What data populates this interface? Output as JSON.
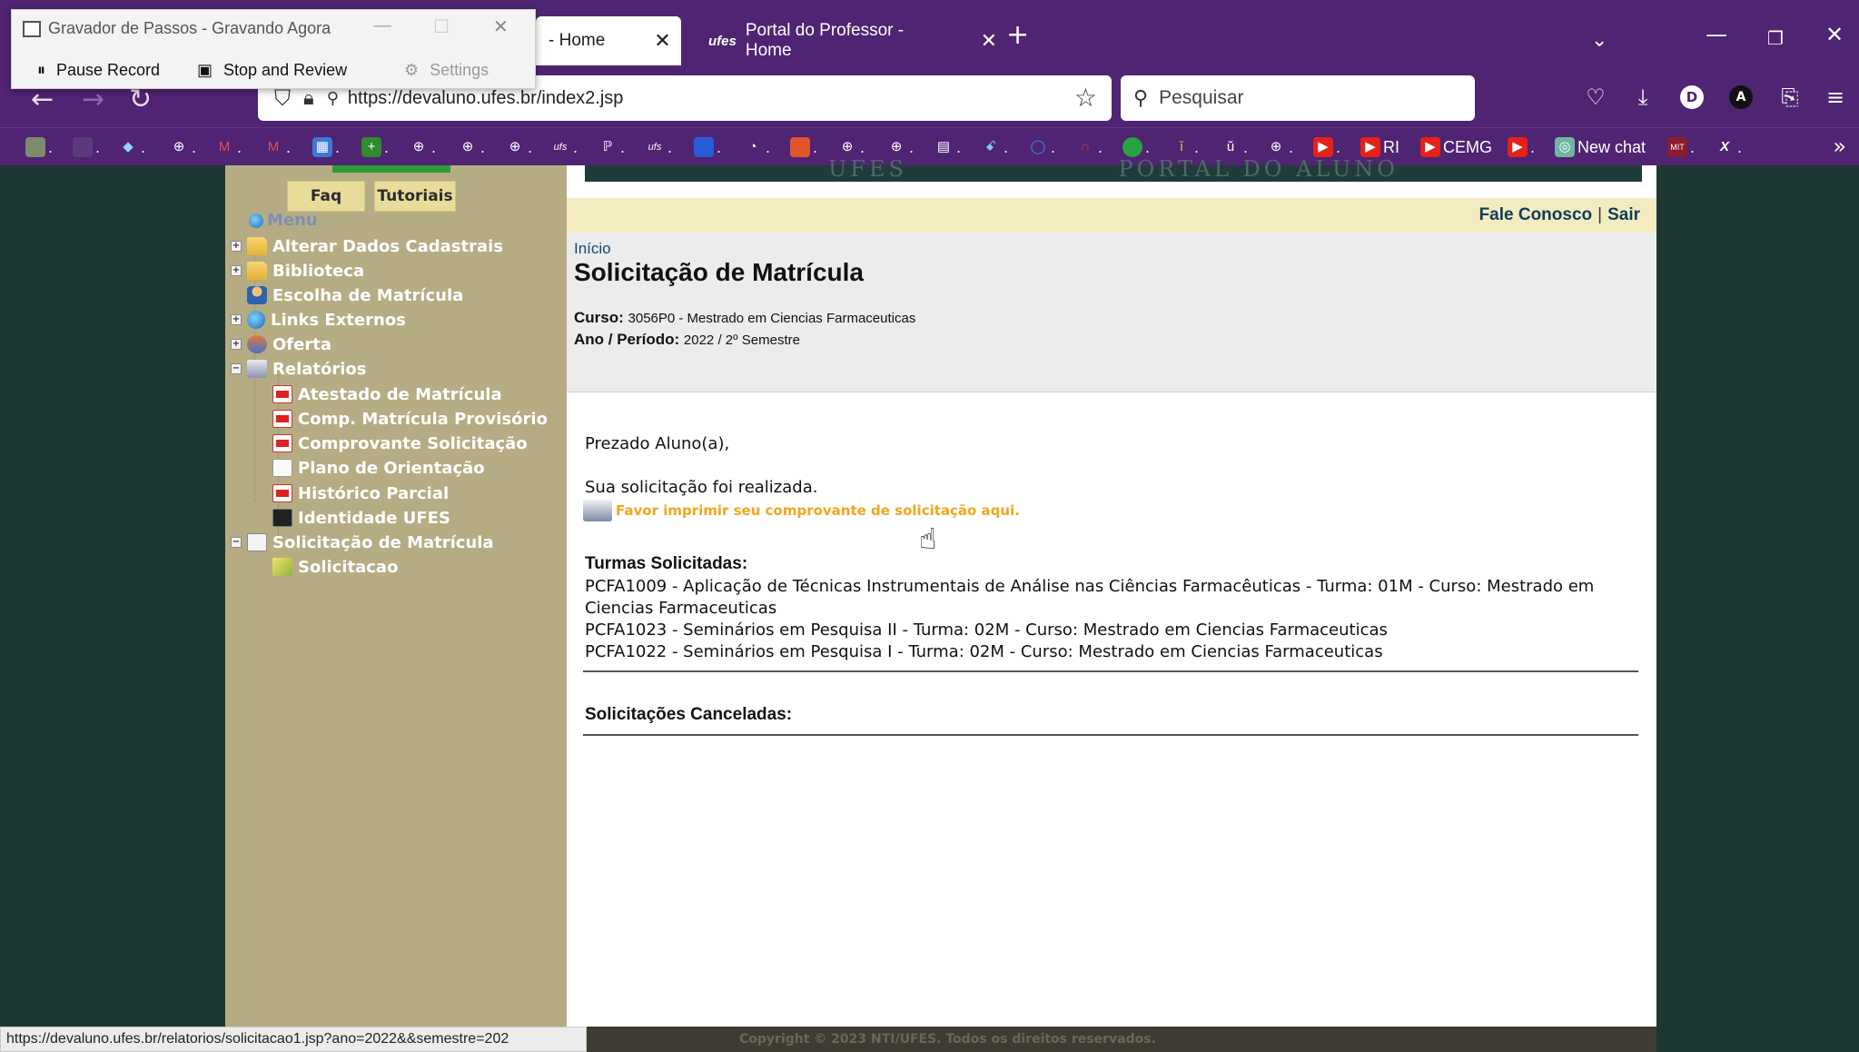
{
  "browser": {
    "tabs": [
      {
        "label": "- Home",
        "active": true
      },
      {
        "label": "Portal do Professor - Home",
        "active": false,
        "icon": "ufes-logo"
      }
    ],
    "url": "https://devaluno.ufes.br/index2.jsp",
    "search_placeholder": "Pesquisar",
    "bookmarks": [
      "RI",
      "CEMG",
      "New chat"
    ],
    "status_url": "https://devaluno.ufes.br/relatorios/solicitacao1.jsp?ano=2022&&semestre=202"
  },
  "recorder": {
    "title": "Gravador de Passos - Gravando Agora",
    "pause": "Pause Record",
    "stop": "Stop and Review",
    "settings": "Settings"
  },
  "sidebar": {
    "faq": "Faq",
    "tutoriais": "Tutoriais",
    "menu_title": "Menu",
    "items": [
      {
        "label": "Alterar Dados Cadastrais",
        "icon": "folder-icon"
      },
      {
        "label": "Biblioteca",
        "icon": "folder-icon"
      },
      {
        "label": "Escolha de Matrícula",
        "icon": "person-icon"
      },
      {
        "label": "Links Externos",
        "icon": "globe-icon"
      },
      {
        "label": "Oferta",
        "icon": "book-icon"
      },
      {
        "label": "Relatórios",
        "icon": "printer-icon"
      },
      {
        "label": "Atestado de Matrícula",
        "icon": "pdf-icon"
      },
      {
        "label": "Comp. Matrícula Provisório",
        "icon": "pdf-icon"
      },
      {
        "label": "Comprovante Solicitação",
        "icon": "pdf-icon"
      },
      {
        "label": "Plano de Orientação",
        "icon": "document-icon"
      },
      {
        "label": "Histórico Parcial",
        "icon": "pdf-icon"
      },
      {
        "label": "Identidade UFES",
        "icon": "id-card-icon"
      },
      {
        "label": "Solicitação de Matrícula",
        "icon": "calendar-icon"
      },
      {
        "label": "Solicitacao",
        "icon": "pencil-icon"
      }
    ]
  },
  "header": {
    "fale_conosco": "Fale Conosco",
    "separator": "|",
    "sair": "Sair"
  },
  "content": {
    "breadcrumb": "Início",
    "title": "Solicitação de Matrícula",
    "curso_label": "Curso:",
    "curso_value": "3056P0 - Mestrado em Ciencias Farmaceuticas",
    "periodo_label": "Ano / Período:",
    "periodo_value": "2022 / 2º Semestre",
    "greeting": "Prezado Aluno(a),",
    "message": "Sua solicitação foi realizada.",
    "print_link": "Favor imprimir seu comprovante de solicitação aqui.",
    "turmas_title": "Turmas Solicitadas:",
    "turmas": [
      "PCFA1009 - Aplicação de Técnicas Instrumentais de Análise nas Ciências Farmacêuticas - Turma: 01M - Curso: Mestrado em Ciencias Farmaceuticas",
      "PCFA1023 - Seminários em Pesquisa II - Turma: 02M - Curso: Mestrado em Ciencias Farmaceuticas",
      "PCFA1022 - Seminários em Pesquisa I - Turma: 02M - Curso: Mestrado em Ciencias Farmaceuticas"
    ],
    "canceladas_title": "Solicitações Canceladas:"
  },
  "footer": {
    "copyright": "Copyright © 2023 NTI/UFES. Todos os direitos reservados."
  }
}
